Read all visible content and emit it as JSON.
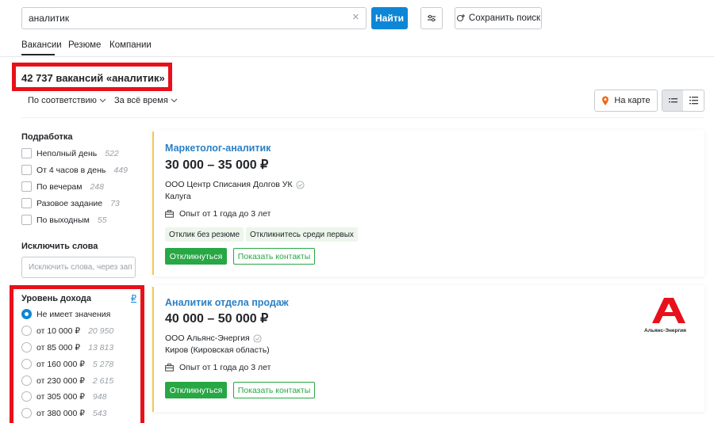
{
  "search": {
    "query": "аналитик",
    "find_label": "Найти",
    "save_label": "Сохранить поиск"
  },
  "tabs": [
    "Вакансии",
    "Резюме",
    "Компании"
  ],
  "results": {
    "title": "42 737 вакансий «аналитик»"
  },
  "sort": {
    "relevance": "По соответствию",
    "period": "За всё время",
    "map_label": "На карте"
  },
  "sidebar": {
    "part_time_title": "Подработка",
    "part_time": [
      {
        "label": "Неполный день",
        "count": "522"
      },
      {
        "label": "От 4 часов в день",
        "count": "449"
      },
      {
        "label": "По вечерам",
        "count": "248"
      },
      {
        "label": "Разовое задание",
        "count": "73"
      },
      {
        "label": "По выходным",
        "count": "55"
      }
    ],
    "exclude_title": "Исключить слова",
    "exclude_placeholder": "Исключить слова, через зап",
    "income_title": "Уровень дохода",
    "currency": "₽",
    "income": [
      {
        "label": "Не имеет значения",
        "count": "",
        "selected": true
      },
      {
        "label": "от 10 000 ₽",
        "count": "20 950",
        "selected": false
      },
      {
        "label": "от 85 000 ₽",
        "count": "13 813",
        "selected": false
      },
      {
        "label": "от 160 000 ₽",
        "count": "5 278",
        "selected": false
      },
      {
        "label": "от 230 000 ₽",
        "count": "2 615",
        "selected": false
      },
      {
        "label": "от 305 000 ₽",
        "count": "948",
        "selected": false
      },
      {
        "label": "от 380 000 ₽",
        "count": "543",
        "selected": false
      }
    ]
  },
  "vacancies": [
    {
      "title": "Маркетолог-аналитик",
      "salary": "30 000 – 35 000 ₽",
      "company": "ООО Центр Списания Долгов УК",
      "city": "Калуга",
      "experience": "Опыт от 1 года до 3 лет",
      "badges": [
        "Отклик без резюме",
        "Откликнитесь среди первых"
      ],
      "apply_label": "Откликнуться",
      "contacts_label": "Показать контакты"
    },
    {
      "title": "Аналитик отдела продаж",
      "salary": "40 000 – 50 000 ₽",
      "company": "ООО Альянс-Энергия",
      "city": "Киров (Кировская область)",
      "experience": "Опыт от 1 года до 3 лет",
      "logo_text": "Альянс-Энергия",
      "apply_label": "Откликнуться",
      "contacts_label": "Показать контакты"
    }
  ],
  "colors": {
    "accent": "#0e86d6",
    "apply": "#28a745",
    "highlight": "#e8101a",
    "title_link": "#2b7fc3"
  }
}
